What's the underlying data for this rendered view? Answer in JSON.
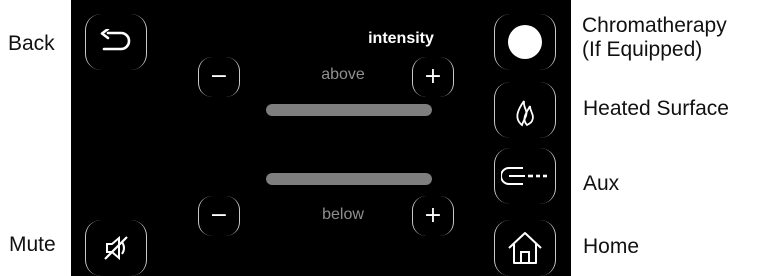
{
  "callouts": {
    "back": "Back",
    "mute": "Mute",
    "chromatherapy_line1": "Chromatherapy",
    "chromatherapy_line2": "(If Equipped)",
    "heated_surface": "Heated Surface",
    "aux": "Aux",
    "home": "Home"
  },
  "screen": {
    "title": "intensity",
    "above": {
      "label": "above",
      "minus": "−",
      "plus": "+",
      "level": 1.0
    },
    "below": {
      "label": "below",
      "minus": "−",
      "plus": "+",
      "level": 1.0
    }
  },
  "icons": {
    "back": "back-arrow-icon",
    "mute": "mute-icon",
    "chromatherapy": "light-circle-icon",
    "heated_surface": "flame-icon",
    "aux": "aux-plug-icon",
    "home": "home-icon"
  },
  "colors": {
    "panel": "#000000",
    "outline": "#c8c8c8",
    "bar": "#7e7e7e",
    "label": "#8f8f8f"
  }
}
